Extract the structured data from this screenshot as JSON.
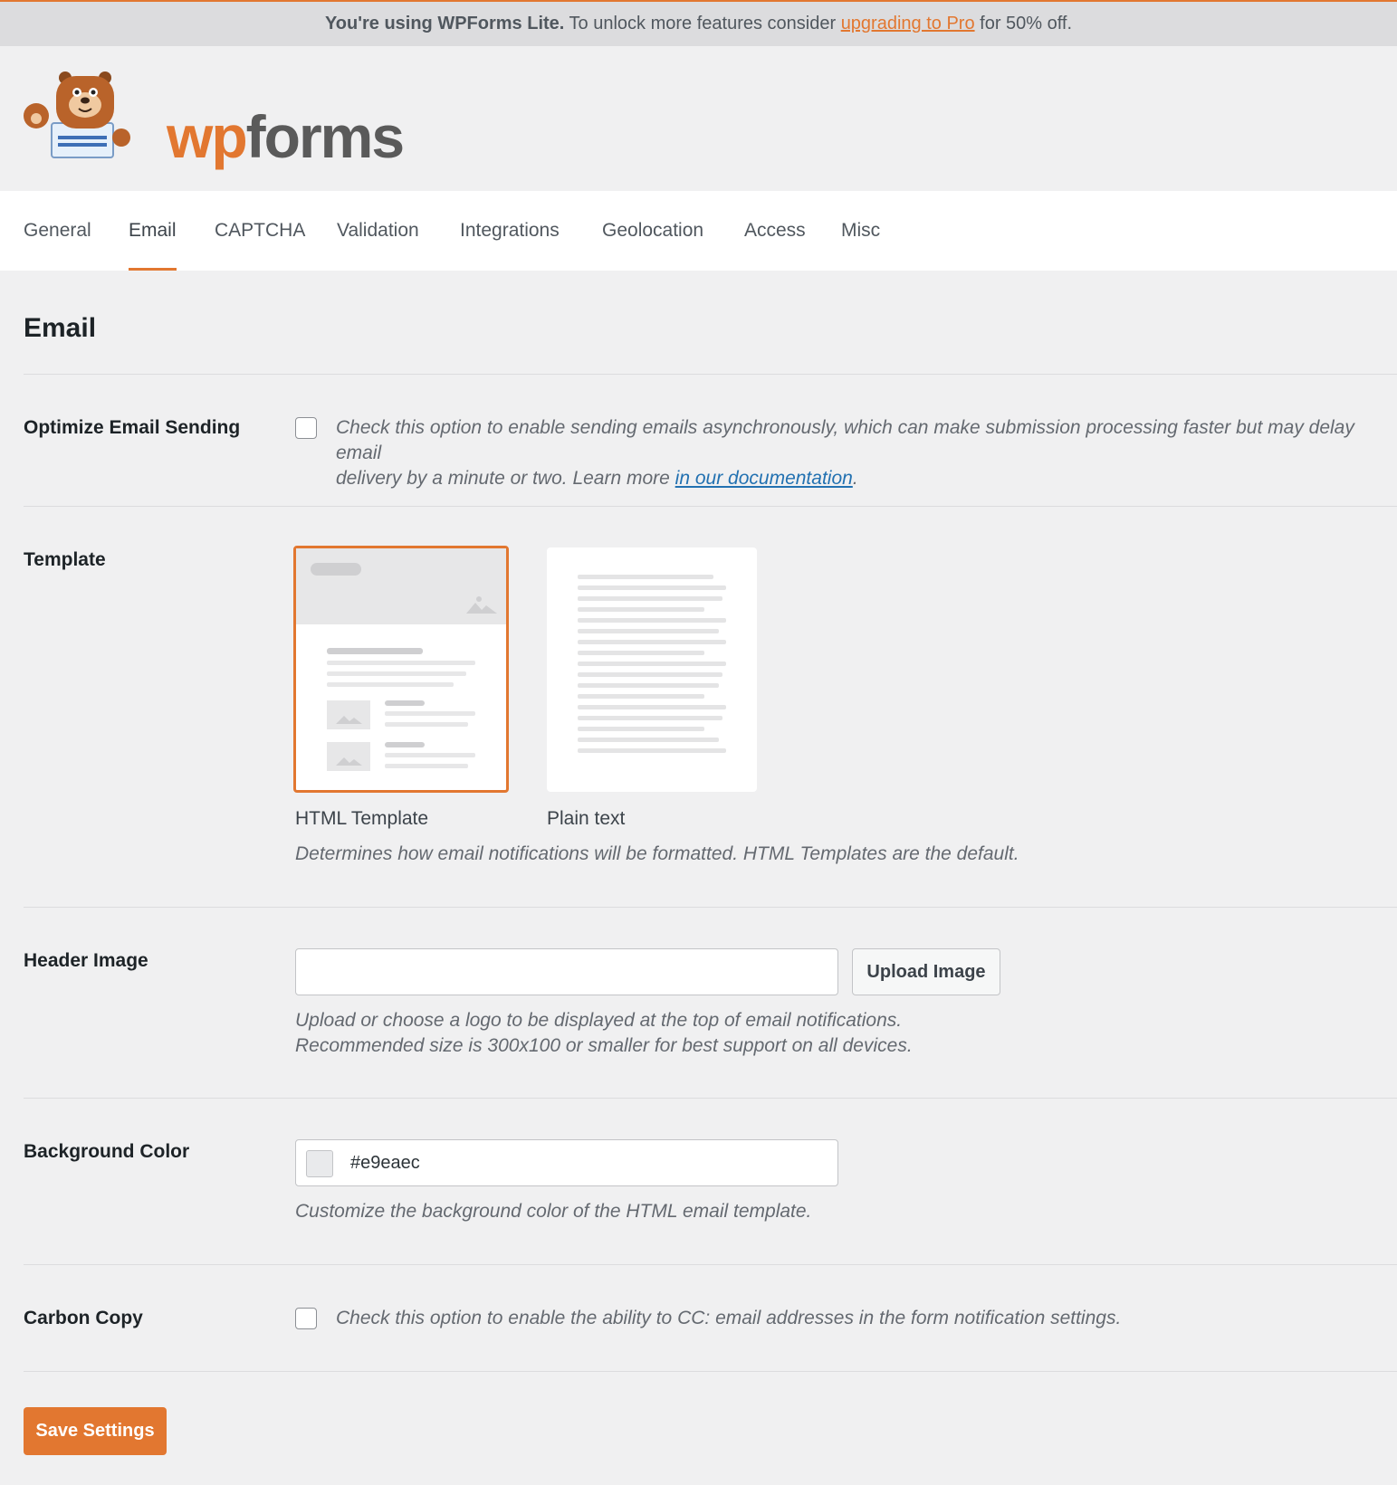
{
  "banner": {
    "strong": "You're using WPForms Lite.",
    "text_before": " To unlock more features consider ",
    "link": "upgrading to Pro",
    "text_after": " for 50% off."
  },
  "logo": {
    "part1": "wp",
    "part2": "forms"
  },
  "tabs": [
    {
      "label": "General"
    },
    {
      "label": "Email",
      "active": true
    },
    {
      "label": "CAPTCHA"
    },
    {
      "label": "Validation"
    },
    {
      "label": "Integrations"
    },
    {
      "label": "Geolocation"
    },
    {
      "label": "Access"
    },
    {
      "label": "Misc"
    }
  ],
  "page_title": "Email",
  "optimize": {
    "label": "Optimize Email Sending",
    "checked": false,
    "desc_1": "Check this option to enable sending emails asynchronously, which can make submission processing faster but may delay email",
    "desc_2": "delivery by a minute or two. Learn more ",
    "link": "in our documentation",
    "desc_end": "."
  },
  "template": {
    "label": "Template",
    "options": [
      {
        "label": "HTML Template",
        "selected": true
      },
      {
        "label": "Plain text",
        "selected": false
      }
    ],
    "desc": "Determines how email notifications will be formatted. HTML Templates are the default."
  },
  "header_image": {
    "label": "Header Image",
    "value": "",
    "button": "Upload Image",
    "desc_1": "Upload or choose a logo to be displayed at the top of email notifications.",
    "desc_2": "Recommended size is 300x100 or smaller for best support on all devices."
  },
  "background_color": {
    "label": "Background Color",
    "value": "#e9eaec",
    "swatch": "#e9eaec",
    "desc": "Customize the background color of the HTML email template."
  },
  "carbon_copy": {
    "label": "Carbon Copy",
    "checked": false,
    "desc": "Check this option to enable the ability to CC: email addresses in the form notification settings."
  },
  "save_button": "Save Settings",
  "colors": {
    "accent": "#e27730",
    "background": "#f0f0f1",
    "link": "#2271b1"
  }
}
